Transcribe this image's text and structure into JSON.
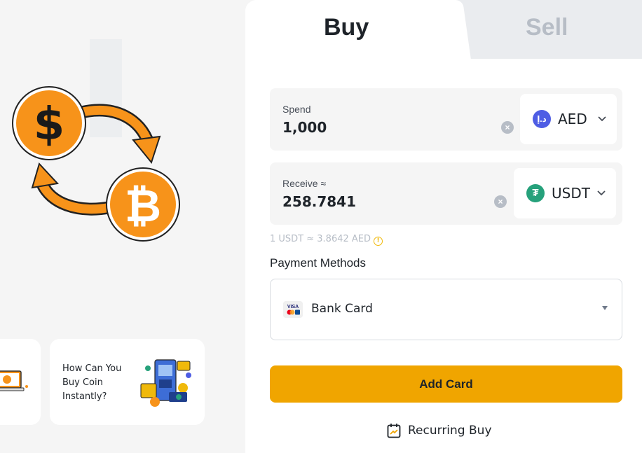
{
  "tabs": {
    "buy": "Buy",
    "sell": "Sell"
  },
  "spend": {
    "label": "Spend",
    "value": "1,000",
    "currency": "AED",
    "currency_glyph": "د.إ",
    "icon": "aed-coin-icon"
  },
  "receive": {
    "label": "Receive ≈",
    "value": "258.7841",
    "currency": "USDT",
    "currency_glyph": "₮",
    "icon": "tether-coin-icon"
  },
  "rate": {
    "text": "1 USDT ≈ 3.8642 AED",
    "info_glyph": "!"
  },
  "payment": {
    "title": "Payment Methods",
    "selected": "Bank Card",
    "card_icon_text": "VISA"
  },
  "actions": {
    "add_card": "Add Card",
    "recurring": "Recurring Buy"
  },
  "promo": {
    "card_text": "How Can You Buy Coin Instantly?"
  },
  "illustration": {
    "dollar_glyph": "$",
    "bitcoin_glyph": "₿"
  },
  "colors": {
    "accent": "#f0a500",
    "orange": "#f7931a",
    "aed": "#4e5de4",
    "usdt": "#26a17b"
  }
}
